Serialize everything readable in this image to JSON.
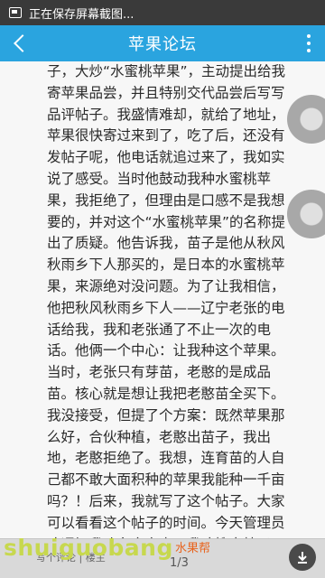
{
  "status_bar": {
    "text": "正在保存屏幕截图..."
  },
  "nav": {
    "title": "苹果论坛"
  },
  "article": {
    "text": "子，大炒“水蜜桃苹果”，主动提出给我寄苹果品尝，并且特别交代品尝后写写品评帖子。我盛情难却，就给了地址，苹果很快寄过来到了，吃了后，还没有发帖子呢，他电话就追过来了，我如实说了感受。当时他鼓动我种水蜜桃苹果，我拒绝了，但理由是口感不是我想要的，并对这个“水蜜桃苹果”的名称提出了质疑。他告诉我，苗子是他从秋风秋雨乡下人那买的，是日本的水蜜桃苹果，来源绝对没问题。为了让我相信，他把秋风秋雨乡下人——辽宁老张的电话给我，我和老张通了不止一次的电话。他俩一个中心：让我种这个苹果。当时，老张只有芽苗，老憨的是成品苗。核心就是想让我把老憨苗全买下。我没接受，但提了个方案：既然苹果那么好，合伙种植，老憨出苗子，我出地，老憨拒绝了。我想，连育苗的人自己都不敢大面积种的苹果我能种一千亩吗？！后来，我就写了这个帖子。大家可以看看这个帖子的时间。今天管理员才通知我改名字之事，我才搜出帖子一"
  },
  "footer": {
    "hint": "写个评论 | 楼主",
    "page": "1/3",
    "watermark": "shuiguobang",
    "watermark_seal": "水果帮"
  }
}
